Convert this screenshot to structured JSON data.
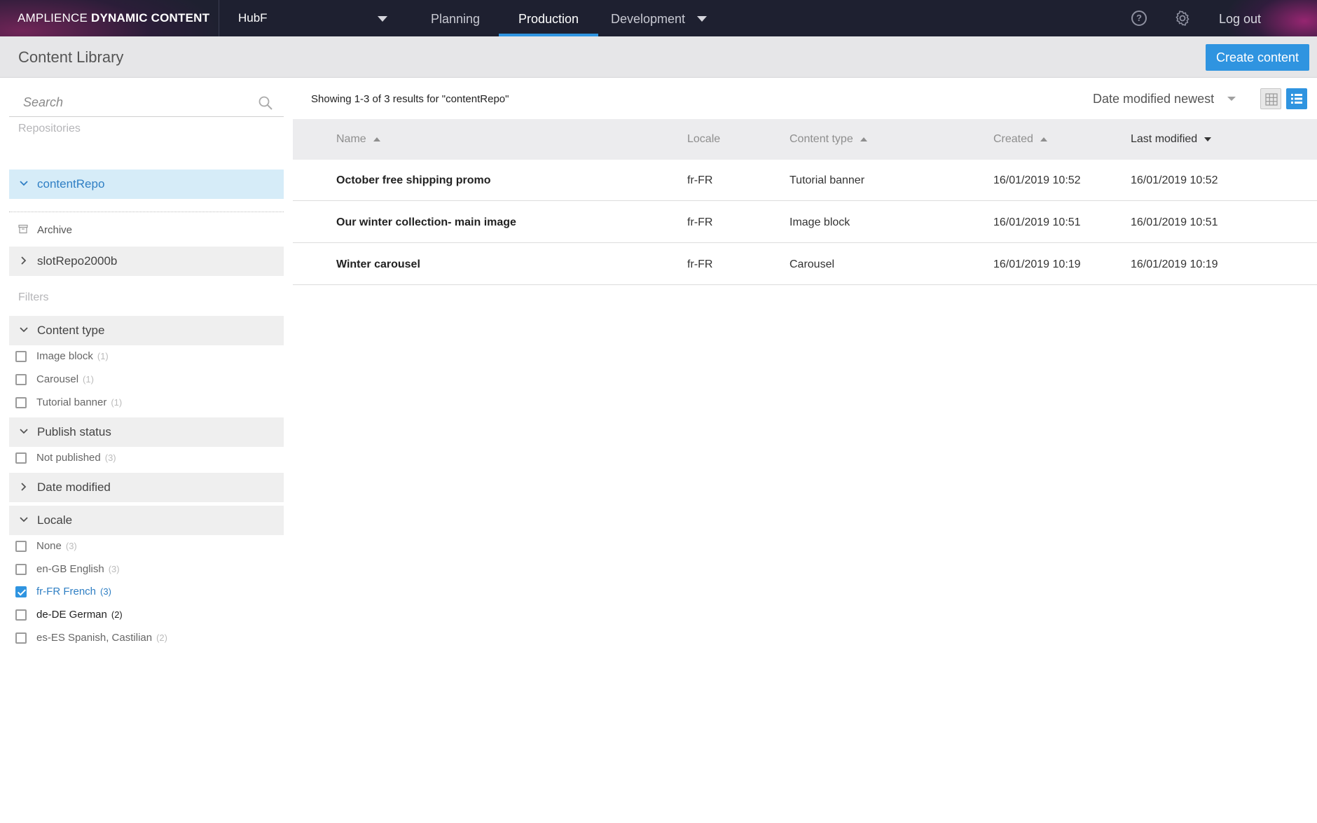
{
  "nav": {
    "brand_light": "AMPLIENCE",
    "brand_bold": "DYNAMIC CONTENT",
    "hub": "HubF",
    "tabs": [
      "Planning",
      "Production",
      "Development"
    ],
    "active_tab": "Production",
    "help_glyph": "?",
    "logout": "Log out"
  },
  "header": {
    "title": "Content Library",
    "create_button": "Create content"
  },
  "sidebar": {
    "search_placeholder": "Search",
    "repositories_label": "Repositories",
    "repositories": [
      {
        "name": "contentRepo",
        "selected": true
      },
      {
        "name": "slotRepo2000b",
        "selected": false
      }
    ],
    "archive_label": "Archive",
    "filters_label": "Filters",
    "filters": {
      "content_type": {
        "label": "Content type",
        "options": [
          {
            "label": "Image block",
            "count": "(1)"
          },
          {
            "label": "Carousel",
            "count": "(1)"
          },
          {
            "label": "Tutorial banner",
            "count": "(1)"
          }
        ]
      },
      "publish_status": {
        "label": "Publish status",
        "options": [
          {
            "label": "Not published",
            "count": "(3)"
          }
        ]
      },
      "date_modified": {
        "label": "Date modified"
      },
      "locale": {
        "label": "Locale",
        "options": [
          {
            "label": "None",
            "count": "(3)",
            "checked": false
          },
          {
            "label": "en-GB English",
            "count": "(3)",
            "checked": false
          },
          {
            "label": "fr-FR French",
            "count": "(3)",
            "checked": true
          },
          {
            "label": "de-DE German",
            "count": "(2)",
            "checked": false
          },
          {
            "label": "es-ES Spanish, Castilian",
            "count": "(2)",
            "checked": false
          }
        ]
      }
    }
  },
  "main": {
    "results_text": "Showing 1-3 of 3 results for \"contentRepo\"",
    "sort_label": "Date modified newest",
    "columns": {
      "name": "Name",
      "locale": "Locale",
      "content_type": "Content type",
      "created": "Created",
      "last_modified": "Last modified"
    },
    "rows": [
      {
        "name": "October free shipping promo",
        "locale": "fr-FR",
        "content_type": "Tutorial banner",
        "created": "16/01/2019 10:52",
        "last_modified": "16/01/2019 10:52"
      },
      {
        "name": "Our winter collection- main image",
        "locale": "fr-FR",
        "content_type": "Image block",
        "created": "16/01/2019 10:51",
        "last_modified": "16/01/2019 10:51"
      },
      {
        "name": "Winter carousel",
        "locale": "fr-FR",
        "content_type": "Carousel",
        "created": "16/01/2019 10:19",
        "last_modified": "16/01/2019 10:19"
      }
    ]
  },
  "colors": {
    "nav_bg": "#1e2030",
    "accent": "#2f94e0",
    "selected_bg": "#d6ecf8"
  }
}
